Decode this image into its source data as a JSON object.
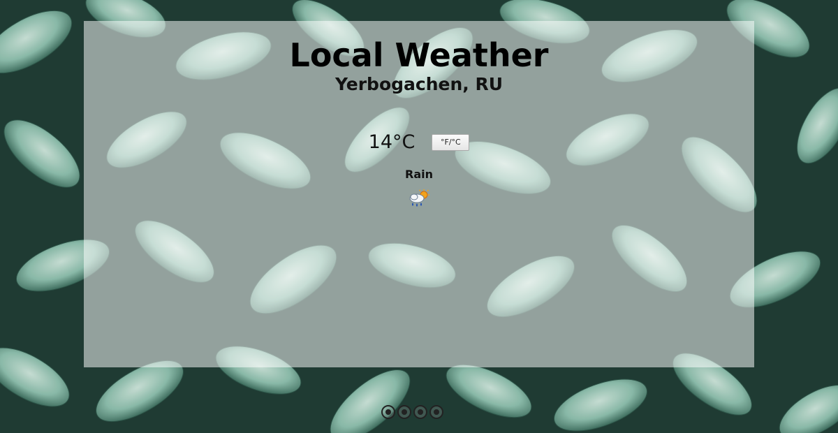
{
  "page": {
    "title": "Local Weather",
    "location": "Yerbogachen, RU",
    "temperature": "14°C",
    "unit_toggle_label": "°F/°C",
    "condition": "Rain",
    "condition_icon": "rain-sun-icon"
  },
  "footer": {
    "icons": [
      "github-icon",
      "codepen-icon",
      "twitter-icon",
      "linkedin-icon"
    ]
  },
  "colors": {
    "background": "#1f3b33",
    "leaf": "#7fb3a0",
    "panel": "rgba(255,255,255,0.52)"
  }
}
